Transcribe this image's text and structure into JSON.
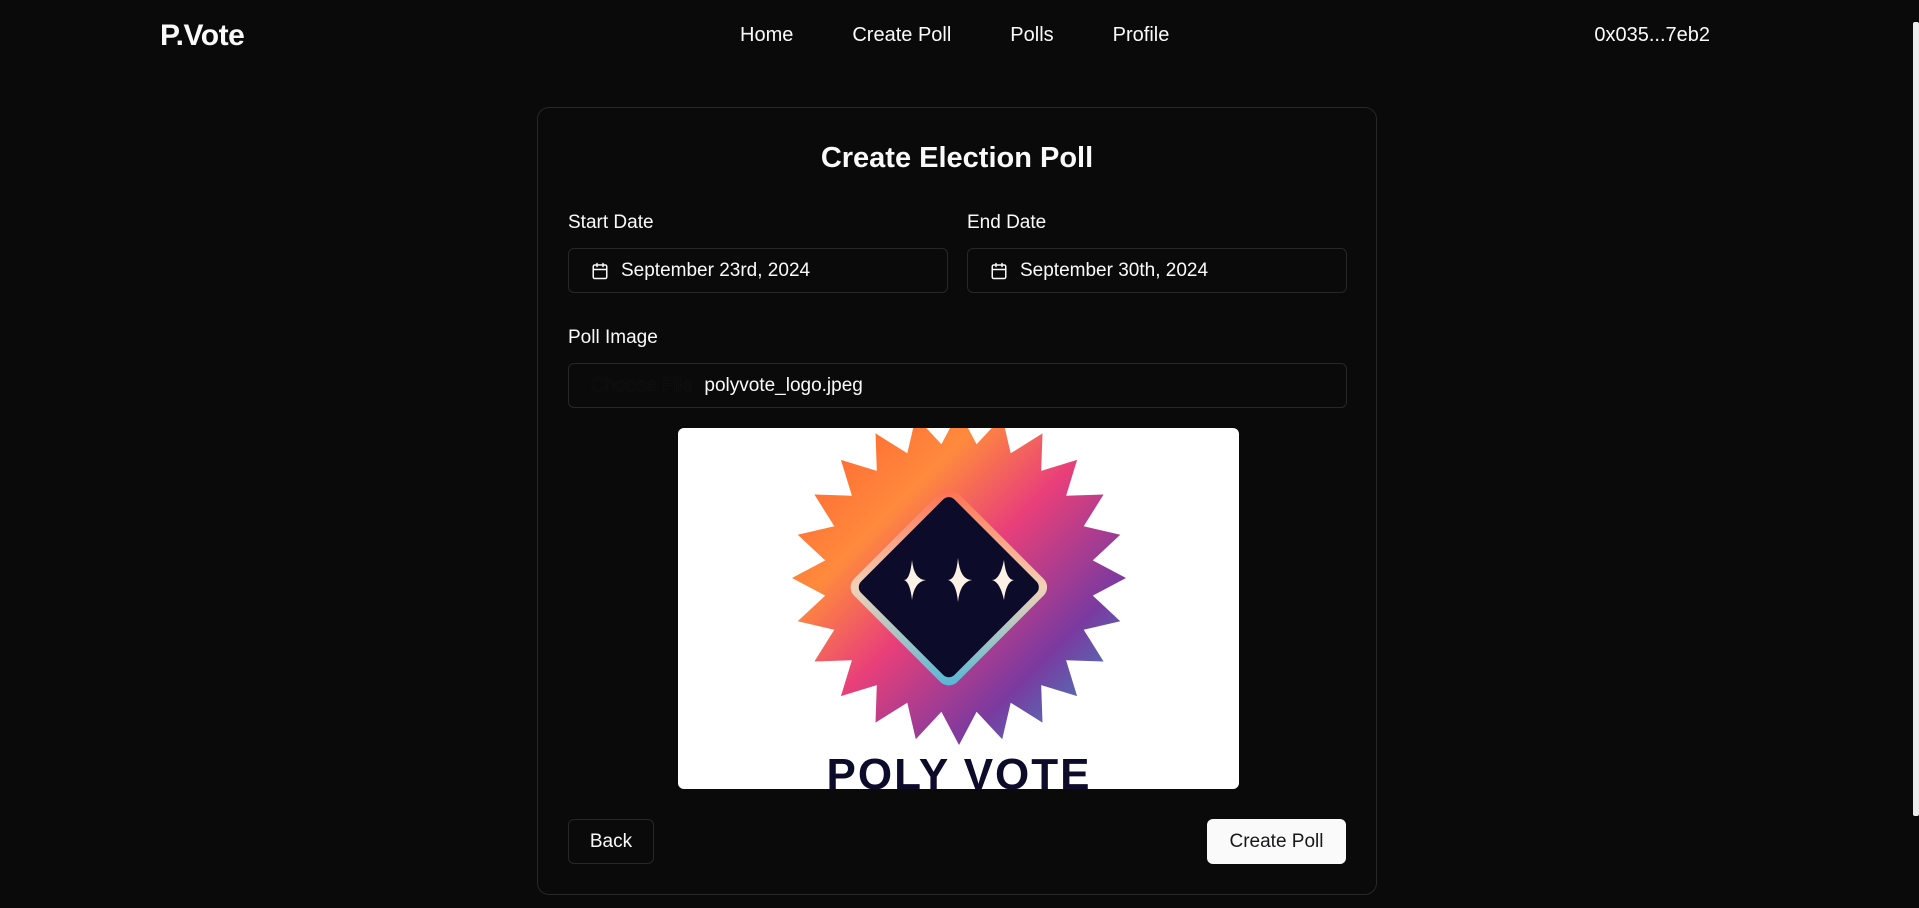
{
  "header": {
    "brand": "P.Vote",
    "nav": [
      {
        "label": "Home"
      },
      {
        "label": "Create Poll"
      },
      {
        "label": "Polls"
      },
      {
        "label": "Profile"
      }
    ],
    "wallet": "0x035...7eb2"
  },
  "form": {
    "title": "Create Election Poll",
    "start_date": {
      "label": "Start Date",
      "value": "September 23rd, 2024",
      "icon": "calendar-icon"
    },
    "end_date": {
      "label": "End Date",
      "value": "September 30th, 2024",
      "icon": "calendar-icon"
    },
    "image": {
      "label": "Poll Image",
      "choose_text": "Choose File",
      "file_name": "polyvote_logo.jpeg",
      "preview_text": "POLY VOTE"
    },
    "back_label": "Back",
    "submit_label": "Create Poll"
  },
  "colors": {
    "background": "#0a0a0a",
    "border": "#27272a",
    "text": "#fafafa",
    "primary_button": "#fafafa",
    "logo_dark": "#0c0b2a"
  }
}
